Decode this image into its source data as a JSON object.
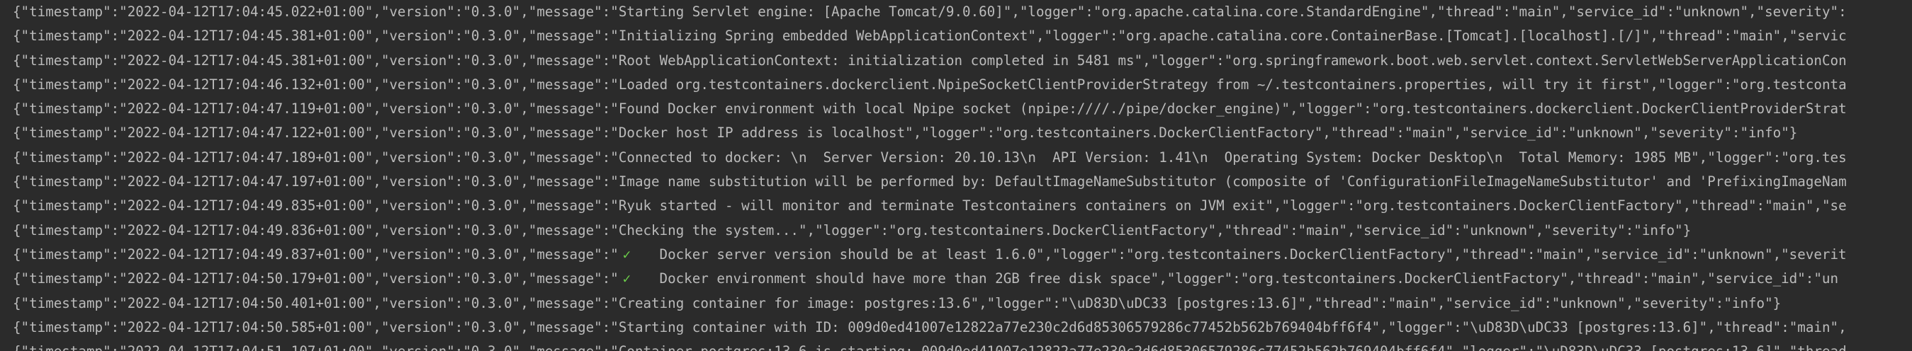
{
  "log_lines": [
    {
      "text": "{\"timestamp\":\"2022-04-12T17:04:45.022+01:00\",\"version\":\"0.3.0\",\"message\":\"Starting Servlet engine: [Apache Tomcat/9.0.60]\",\"logger\":\"org.apache.catalina.core.StandardEngine\",\"thread\":\"main\",\"service_id\":\"unknown\",\"severity\":"
    },
    {
      "text": "{\"timestamp\":\"2022-04-12T17:04:45.381+01:00\",\"version\":\"0.3.0\",\"message\":\"Initializing Spring embedded WebApplicationContext\",\"logger\":\"org.apache.catalina.core.ContainerBase.[Tomcat].[localhost].[/]\",\"thread\":\"main\",\"servic"
    },
    {
      "text": "{\"timestamp\":\"2022-04-12T17:04:45.381+01:00\",\"version\":\"0.3.0\",\"message\":\"Root WebApplicationContext: initialization completed in 5481 ms\",\"logger\":\"org.springframework.boot.web.servlet.context.ServletWebServerApplicationCon"
    },
    {
      "text": "{\"timestamp\":\"2022-04-12T17:04:46.132+01:00\",\"version\":\"0.3.0\",\"message\":\"Loaded org.testcontainers.dockerclient.NpipeSocketClientProviderStrategy from ~/.testcontainers.properties, will try it first\",\"logger\":\"org.testconta"
    },
    {
      "text": "{\"timestamp\":\"2022-04-12T17:04:47.119+01:00\",\"version\":\"0.3.0\",\"message\":\"Found Docker environment with local Npipe socket (npipe:////./pipe/docker_engine)\",\"logger\":\"org.testcontainers.dockerclient.DockerClientProviderStrat"
    },
    {
      "text": "{\"timestamp\":\"2022-04-12T17:04:47.122+01:00\",\"version\":\"0.3.0\",\"message\":\"Docker host IP address is localhost\",\"logger\":\"org.testcontainers.DockerClientFactory\",\"thread\":\"main\",\"service_id\":\"unknown\",\"severity\":\"info\"}"
    },
    {
      "text": "{\"timestamp\":\"2022-04-12T17:04:47.189+01:00\",\"version\":\"0.3.0\",\"message\":\"Connected to docker: \\n  Server Version: 20.10.13\\n  API Version: 1.41\\n  Operating System: Docker Desktop\\n  Total Memory: 1985 MB\",\"logger\":\"org.tes"
    },
    {
      "text": "{\"timestamp\":\"2022-04-12T17:04:47.197+01:00\",\"version\":\"0.3.0\",\"message\":\"Image name substitution will be performed by: DefaultImageNameSubstitutor (composite of 'ConfigurationFileImageNameSubstitutor' and 'PrefixingImageNam"
    },
    {
      "text": "{\"timestamp\":\"2022-04-12T17:04:49.835+01:00\",\"version\":\"0.3.0\",\"message\":\"Ryuk started - will monitor and terminate Testcontainers containers on JVM exit\",\"logger\":\"org.testcontainers.DockerClientFactory\",\"thread\":\"main\",\"se"
    },
    {
      "text": "{\"timestamp\":\"2022-04-12T17:04:49.836+01:00\",\"version\":\"0.3.0\",\"message\":\"Checking the system...\",\"logger\":\"org.testcontainers.DockerClientFactory\",\"thread\":\"main\",\"service_id\":\"unknown\",\"severity\":\"info\"}"
    },
    {
      "text_before": "{\"timestamp\":\"2022-04-12T17:04:49.837+01:00\",\"version\":\"0.3.0\",\"message\":\"",
      "icon": "check-mark-icon",
      "glyph": "✓",
      "text_after": "   Docker server version should be at least 1.6.0\",\"logger\":\"org.testcontainers.DockerClientFactory\",\"thread\":\"main\",\"service_id\":\"unknown\",\"severit"
    },
    {
      "text_before": "{\"timestamp\":\"2022-04-12T17:04:50.179+01:00\",\"version\":\"0.3.0\",\"message\":\"",
      "icon": "check-mark-icon",
      "glyph": "✓",
      "text_after": "   Docker environment should have more than 2GB free disk space\",\"logger\":\"org.testcontainers.DockerClientFactory\",\"thread\":\"main\",\"service_id\":\"un"
    },
    {
      "text": "{\"timestamp\":\"2022-04-12T17:04:50.401+01:00\",\"version\":\"0.3.0\",\"message\":\"Creating container for image: postgres:13.6\",\"logger\":\"\\uD83D\\uDC33 [postgres:13.6]\",\"thread\":\"main\",\"service_id\":\"unknown\",\"severity\":\"info\"}"
    },
    {
      "text": "{\"timestamp\":\"2022-04-12T17:04:50.585+01:00\",\"version\":\"0.3.0\",\"message\":\"Starting container with ID: 009d0ed41007e12822a77e230c2d6d85306579286c77452b562b769404bff6f4\",\"logger\":\"\\uD83D\\uDC33 [postgres:13.6]\",\"thread\":\"main\","
    },
    {
      "text": "{\"timestamp\":\"2022-04-12T17:04:51.107+01:00\",\"version\":\"0.3.0\",\"message\":\"Container postgres:13.6 is starting: 009d0ed41007e12822a77e230c2d6d85306579286c77452b562b769404bff6f4\",\"logger\":\"\\uD83D\\uDC33 [postgres:13.6]\",\"thread"
    }
  ],
  "colors": {
    "background": "#2b2b2b",
    "text": "#bbbbbb",
    "check": "#6ccf4a"
  }
}
